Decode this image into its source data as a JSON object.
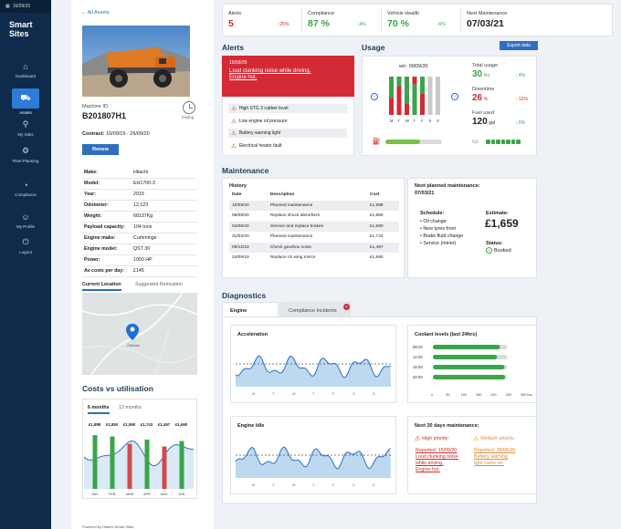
{
  "topbar": {
    "date": "16/09/20"
  },
  "brand": {
    "line1": "Smart",
    "line2": "Sites"
  },
  "nav": [
    {
      "label": "Dashboard",
      "icon": "home-icon"
    },
    {
      "label": "Assets",
      "icon": "truck-icon",
      "active": true
    },
    {
      "label": "My Sites",
      "icon": "pin-icon"
    },
    {
      "label": "Fleet Planning",
      "icon": "gear-icon"
    },
    {
      "label": "Compliance",
      "icon": "gauge-icon"
    },
    {
      "label": "My Profile",
      "icon": "user-icon"
    },
    {
      "label": "Logout",
      "icon": "power-icon"
    }
  ],
  "asset": {
    "back_link": "All Assets",
    "machine_id_label": "Machine ID:",
    "machine_id": "B201807H1",
    "ending_label": "Ending",
    "contract_label": "Contract:",
    "contract": "10/09/19 - 29/09/20",
    "renew": "Renew",
    "specs": [
      [
        "Make:",
        "Hitachi"
      ],
      [
        "Model:",
        "EH1700-3"
      ],
      [
        "Year:",
        "2015"
      ],
      [
        "Odometer:",
        "12,123"
      ],
      [
        "Weight:",
        "68137Kg"
      ],
      [
        "Payload capacity:",
        "104 tons"
      ],
      [
        "Engine make:",
        "Cummings"
      ],
      [
        "Engine model:",
        "QST 30"
      ],
      [
        "Power:",
        "1050 HP"
      ],
      [
        "Av costs per day:",
        "£145"
      ]
    ],
    "location_tabs": [
      "Current Location",
      "Suggested Relocation"
    ],
    "map_label": "Oldham",
    "costs_title": "Costs vs utilisation",
    "cost_tabs": [
      "6 months",
      "12 months"
    ],
    "footer": "Powered by Hitachi Smart Sites"
  },
  "costs_chart": {
    "categories": [
      "JAN",
      "FEB",
      "MAR",
      "APR",
      "MAY",
      "JUN"
    ],
    "values": [
      "£1,898",
      "£1,850",
      "£1,590",
      "£1,743",
      "£1,497",
      "£1,690"
    ],
    "bar_colors": [
      "#3aa54a",
      "#3aa54a",
      "#d24a4a",
      "#3aa54a",
      "#d24a4a",
      "#3aa54a"
    ]
  },
  "kpis": [
    {
      "label": "Alerts",
      "value": "5",
      "change": "25%",
      "dir": "up",
      "color": "#d22a2a"
    },
    {
      "label": "Compliance",
      "value": "87 %",
      "change": "4%",
      "dir": "down",
      "color": "#3aa54a"
    },
    {
      "label": "Vehicle Health",
      "value": "70 %",
      "change": "6%",
      "dir": "down",
      "color": "#3aa54a"
    },
    {
      "label": "Next Maintenance",
      "value": "07/03/21",
      "change": "",
      "dir": "",
      "color": "#222222"
    }
  ],
  "alerts": {
    "title": "Alerts",
    "main_date": "15/09/20",
    "main_text_1": "Loud clanking noise while driving.",
    "main_text_2": "Engine hot.",
    "items": [
      "High STG 3 rubber level",
      "Low engine oil pressure",
      "Battery warning light",
      "Electrical heater fault"
    ]
  },
  "usage": {
    "title": "Usage",
    "export": "Export data",
    "week": "w/c: 09/09/20",
    "days": [
      "M",
      "T",
      "W",
      "T",
      "F",
      "S",
      "S"
    ],
    "total_label": "Total usage",
    "total_value": "30",
    "total_unit": "hrs",
    "total_change": "4%",
    "down_label": "Downtime",
    "down_value": "26",
    "down_unit": "%",
    "down_change": "12%",
    "fuel_label": "Fuel used",
    "fuel_value": "120",
    "fuel_unit": "gal",
    "fuel_change": "6%",
    "fuel_level": 0.62,
    "battery_level": 0.86
  },
  "maintenance": {
    "title": "Maintenance",
    "history_title": "History",
    "cols": [
      "Date",
      "Description",
      "Cost"
    ],
    "rows": [
      [
        "10/09/20",
        "Planned maintenance",
        "£1,998"
      ],
      [
        "05/08/20",
        "Replace shock absorbers",
        "£1,850"
      ],
      [
        "04/06/20",
        "Service and replace brakes",
        "£1,590"
      ],
      [
        "31/03/20",
        "Planned maintenance",
        "£1,743"
      ],
      [
        "09/12/19",
        "Check gearbox noise",
        "£1,497"
      ],
      [
        "24/09/19",
        "Replace r/s wing mirror",
        "£1,690"
      ]
    ],
    "next_title": "Next planned maintenance:",
    "next_date": "07/03/21",
    "schedule_title": "Schedule:",
    "schedule": [
      "• Oil change",
      "• New tyres front",
      "• Brake fluid change",
      "• Service (minor)"
    ],
    "estimate_label": "Estimate:",
    "estimate": "£1,659",
    "status_label": "Status:",
    "status": "Booked"
  },
  "diagnostics": {
    "title": "Diagnostics",
    "tabs": [
      "Engine",
      "Compliance Incidents"
    ],
    "accel_title": "Acceleration",
    "idle_title": "Engine Idle",
    "wave_ticks": [
      "M",
      "T",
      "W",
      "T",
      "F",
      "S",
      "S"
    ],
    "coolant_title": "Coolant levels (last 24hrs)",
    "coolant_rows": [
      {
        "time": "08:00",
        "value": 225
      },
      {
        "time": "12:00",
        "value": 215
      },
      {
        "time": "16:00",
        "value": 240
      },
      {
        "time": "20:00",
        "value": 242
      }
    ],
    "coolant_axis": [
      "0",
      "50",
      "100",
      "150",
      "200",
      "250",
      "300 hrs"
    ],
    "coolant_max": 300,
    "next30_title": "Next 30 days maintenance:",
    "high_label": "High priority:",
    "high_text": [
      "Reported: 15/09/20",
      "Loud clunking noise",
      "while driving.",
      "Engine hot."
    ],
    "med_label": "Medium priority:",
    "med_text": [
      "Reported: 28/08/20",
      "Battery warning",
      "light came on."
    ]
  }
}
